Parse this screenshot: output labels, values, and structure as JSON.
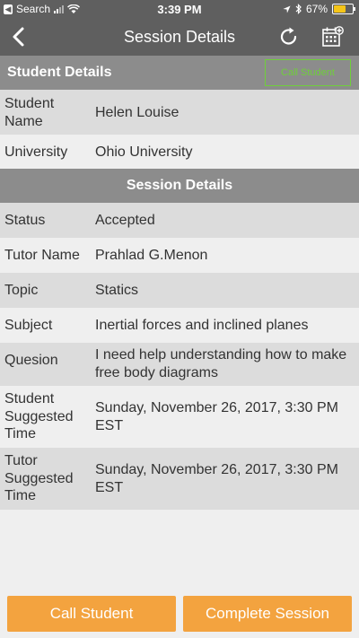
{
  "status_bar": {
    "back_app": "Search",
    "time": "3:39 PM",
    "battery": "67%"
  },
  "nav": {
    "title": "Session Details"
  },
  "student_section": {
    "title": "Student Details",
    "call_button": "Call Student",
    "rows": [
      {
        "label": "Student Name",
        "value": "Helen Louise"
      },
      {
        "label": "University",
        "value": "Ohio University"
      }
    ]
  },
  "session_section": {
    "title": "Session Details",
    "rows": [
      {
        "label": "Status",
        "value": "Accepted"
      },
      {
        "label": "Tutor Name",
        "value": "Prahlad G.Menon"
      },
      {
        "label": "Topic",
        "value": "Statics"
      },
      {
        "label": "Subject",
        "value": "Inertial forces and inclined planes"
      },
      {
        "label": "Quesion",
        "value": "I need help understanding how to make free body diagrams"
      },
      {
        "label": "Student Suggested Time",
        "value": "Sunday, November 26, 2017,  3:30 PM EST"
      },
      {
        "label": "Tutor Suggested Time",
        "value": "Sunday, November 26, 2017,  3:30 PM EST"
      }
    ]
  },
  "actions": {
    "call_student": "Call Student",
    "complete_session": "Complete Session"
  },
  "colors": {
    "nav_bg": "#5f5f5f",
    "section_header_bg": "#8c8c8c",
    "accent_orange": "#f3a33f",
    "call_outline_green": "#6fcf3a"
  }
}
